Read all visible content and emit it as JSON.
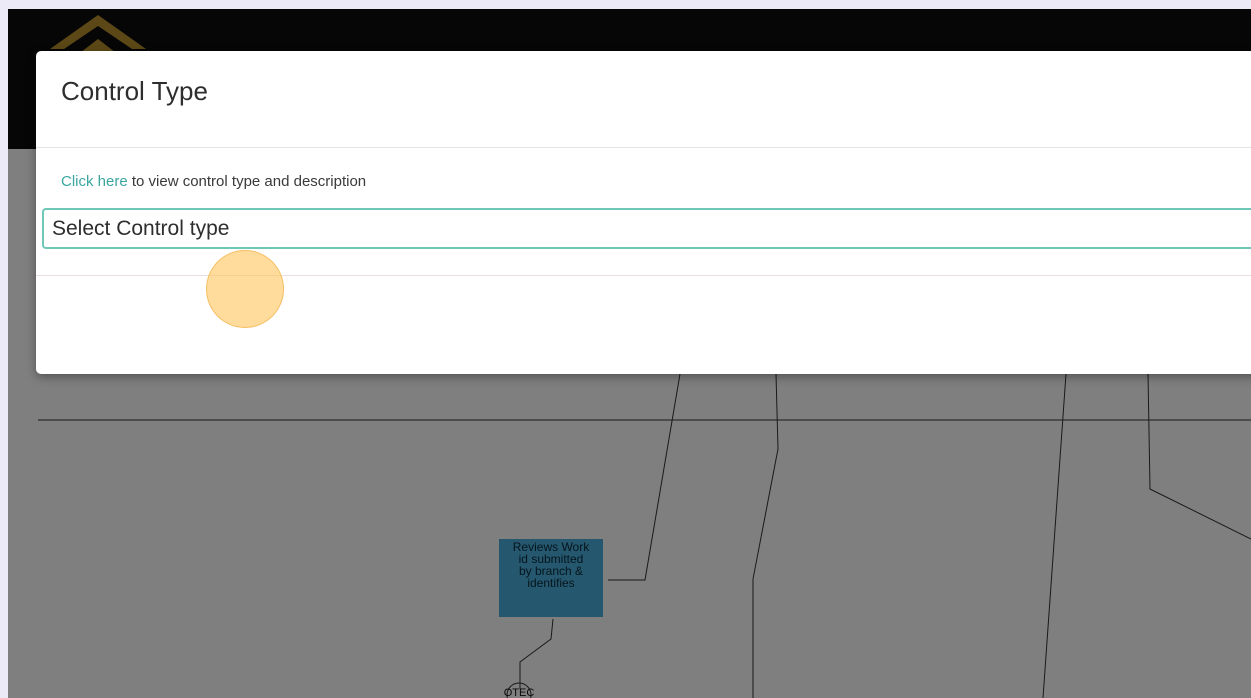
{
  "colors": {
    "top_bar": "#0d0d0d",
    "logo_gold": "#b8902c",
    "link": "#3aa6a0",
    "field_border": "#6fc7b8",
    "process_box": "#4aaedc",
    "click_highlight": "#ffc45a"
  },
  "modal": {
    "title": "Control Type",
    "hint_link": "Click here",
    "hint_text": " to view control type and description",
    "select_placeholder": "Select Control type"
  },
  "canvas": {
    "process_box_lines": [
      "Reviews Work",
      "id submitted",
      "by branch &",
      "identifies"
    ],
    "node_label": "OTEC"
  },
  "icons": {
    "logo": "house-logo-icon"
  }
}
